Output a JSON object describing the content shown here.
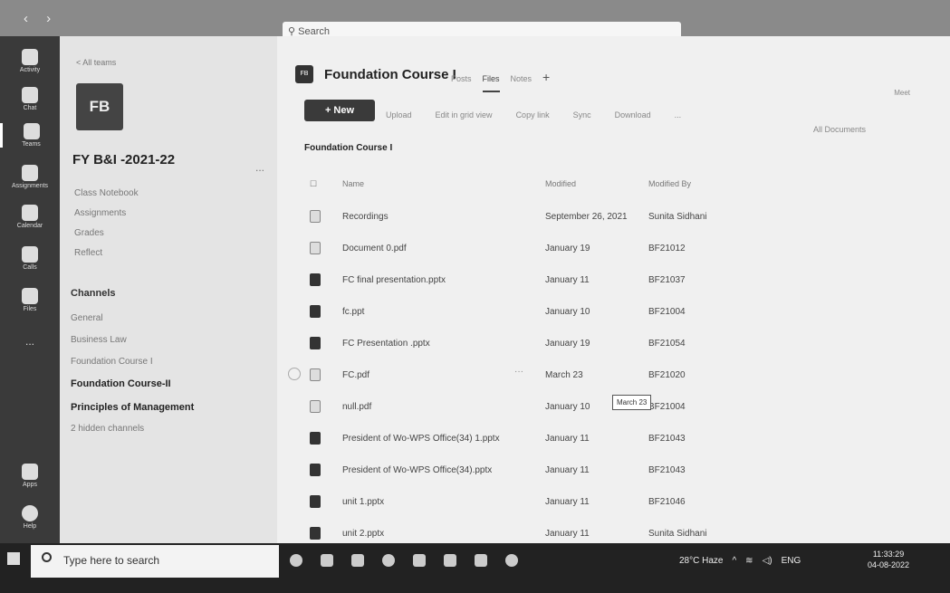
{
  "search": {
    "placeholder": "Search"
  },
  "rail": [
    {
      "label": "Activity"
    },
    {
      "label": "Chat"
    },
    {
      "label": "Teams"
    },
    {
      "label": "Assignments"
    },
    {
      "label": "Calendar"
    },
    {
      "label": "Calls"
    },
    {
      "label": "Files"
    },
    {
      "label": "..."
    },
    {
      "label": "Apps"
    },
    {
      "label": "Help"
    }
  ],
  "sidebar": {
    "back": "< All teams",
    "tile": "FB",
    "team_name": "FY B&I -2021-22",
    "more": "...",
    "links": [
      "Class Notebook",
      "Assignments",
      "Grades",
      "Reflect"
    ],
    "channels_heading": "Channels",
    "channels": [
      "General",
      "Business Law",
      "Foundation Course I",
      "Foundation Course-II",
      "Principles of Management",
      "2 hidden channels"
    ]
  },
  "header": {
    "icon": "FB",
    "title": "Foundation Course I",
    "tabs": [
      "Posts",
      "Files",
      "Notes"
    ],
    "add_tab": "+",
    "meet": "Meet"
  },
  "toolbar": {
    "new_label": "+ New",
    "actions": [
      "Upload",
      "Edit in grid view",
      "Copy link",
      "Sync",
      "Download",
      "..."
    ],
    "all_docs": "All Documents"
  },
  "breadcrumb": "Foundation Course I",
  "columns": {
    "name": "Name",
    "modified": "Modified",
    "modified_by": "Modified By"
  },
  "files": [
    {
      "name": "Recordings",
      "modified": "September 26, 2021",
      "by": "Sunita Sidhani",
      "type": "folder"
    },
    {
      "name": "Document 0.pdf",
      "modified": "January 19",
      "by": "BF21012",
      "type": "pdf"
    },
    {
      "name": "FC final presentation.pptx",
      "modified": "January 11",
      "by": "BF21037",
      "type": "ppt"
    },
    {
      "name": "fc.ppt",
      "modified": "January 10",
      "by": "BF21004",
      "type": "ppt"
    },
    {
      "name": "FC Presentation .pptx",
      "modified": "January 19",
      "by": "BF21054",
      "type": "ppt"
    },
    {
      "name": "FC.pdf",
      "modified": "March 23",
      "by": "BF21020",
      "type": "pdf"
    },
    {
      "name": "null.pdf",
      "modified": "January 10",
      "by": "BF21004",
      "type": "pdf"
    },
    {
      "name": "President of Wo-WPS Office(34) 1.pptx",
      "modified": "January 11",
      "by": "BF21043",
      "type": "ppt"
    },
    {
      "name": "President of Wo-WPS Office(34).pptx",
      "modified": "January 11",
      "by": "BF21043",
      "type": "ppt"
    },
    {
      "name": "unit 1.pptx",
      "modified": "January 11",
      "by": "BF21046",
      "type": "ppt"
    },
    {
      "name": "unit 2.pptx",
      "modified": "January 11",
      "by": "Sunita Sidhani",
      "type": "ppt"
    }
  ],
  "tooltip": "March 23",
  "taskbar": {
    "search": "Type here to search",
    "weather": "28°C Haze",
    "lang": "ENG",
    "time": "11:33:29",
    "date": "04-08-2022"
  }
}
